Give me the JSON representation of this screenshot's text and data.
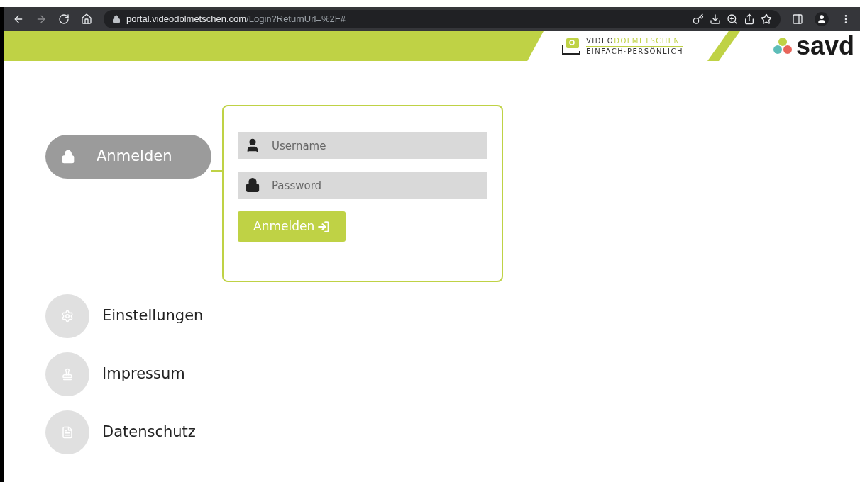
{
  "browser": {
    "url_host": "portal.videodolmetschen.com",
    "url_path": "/Login?ReturnUrl=%2F#"
  },
  "header": {
    "logo_video": "VIDEO",
    "logo_dolmetschen": "DOLMETSCHEN",
    "logo_tagline": "EINFACH·PERSÖNLICH",
    "brand": "savd"
  },
  "nav": [
    {
      "label": "Anmelden",
      "kind": "lock",
      "selected": true
    },
    {
      "label": "Einstellungen",
      "kind": "gear",
      "selected": false
    },
    {
      "label": "Impressum",
      "kind": "stamp",
      "selected": false
    },
    {
      "label": "Datenschutz",
      "kind": "document",
      "selected": false
    }
  ],
  "login": {
    "username": {
      "placeholder": "Username"
    },
    "password": {
      "placeholder": "Password"
    },
    "submit": "Anmelden"
  }
}
